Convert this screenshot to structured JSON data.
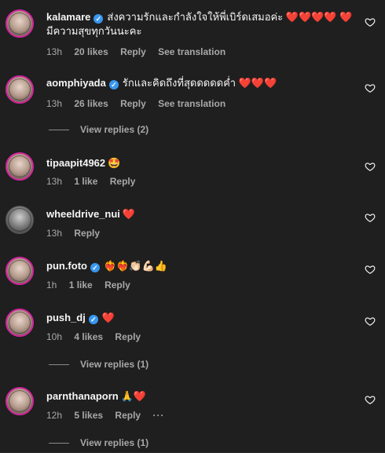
{
  "comments": [
    {
      "username": "kalamare",
      "verified": true,
      "text": "ส่งความรักและกำลังใจให้พี่เบิร์ดเสมอค่ะ ❤️❤️❤️❤️ ❤️ มีความสุขทุกวันนะคะ",
      "time": "13h",
      "likes": "20 likes",
      "reply": "Reply",
      "translation": "See translation"
    },
    {
      "username": "aomphiyada",
      "verified": true,
      "text": "รักและคิดถึงที่สุดดดดดค่ำ ❤️❤️❤️",
      "time": "13h",
      "likes": "26 likes",
      "reply": "Reply",
      "translation": "See translation",
      "view_replies": "View replies (2)"
    },
    {
      "username": "tipaapit4962",
      "verified": false,
      "text": "🤩",
      "time": "13h",
      "likes": "1 like",
      "reply": "Reply"
    },
    {
      "username": "wheeldrive_nui",
      "verified": false,
      "text": "❤️",
      "time": "13h",
      "reply": "Reply"
    },
    {
      "username": "pun.foto",
      "verified": true,
      "text": "❤️‍🔥❤️‍🔥👏🏻💪🏻👍",
      "time": "1h",
      "likes": "1 like",
      "reply": "Reply"
    },
    {
      "username": "push_dj",
      "verified": true,
      "text": "❤️",
      "time": "10h",
      "likes": "4 likes",
      "reply": "Reply",
      "view_replies": "View replies (1)"
    },
    {
      "username": "parnthanaporn",
      "verified": false,
      "text": "🙏❤️",
      "time": "12h",
      "likes": "5 likes",
      "reply": "Reply",
      "more": "···",
      "view_replies": "View replies (1)"
    }
  ],
  "icons": {
    "like": "heart-outline-icon",
    "verified": "verified-badge-icon"
  },
  "colors": {
    "background": "#1f1f1f",
    "verified": "#3897f0",
    "avatar_ring": "#d6249f"
  }
}
